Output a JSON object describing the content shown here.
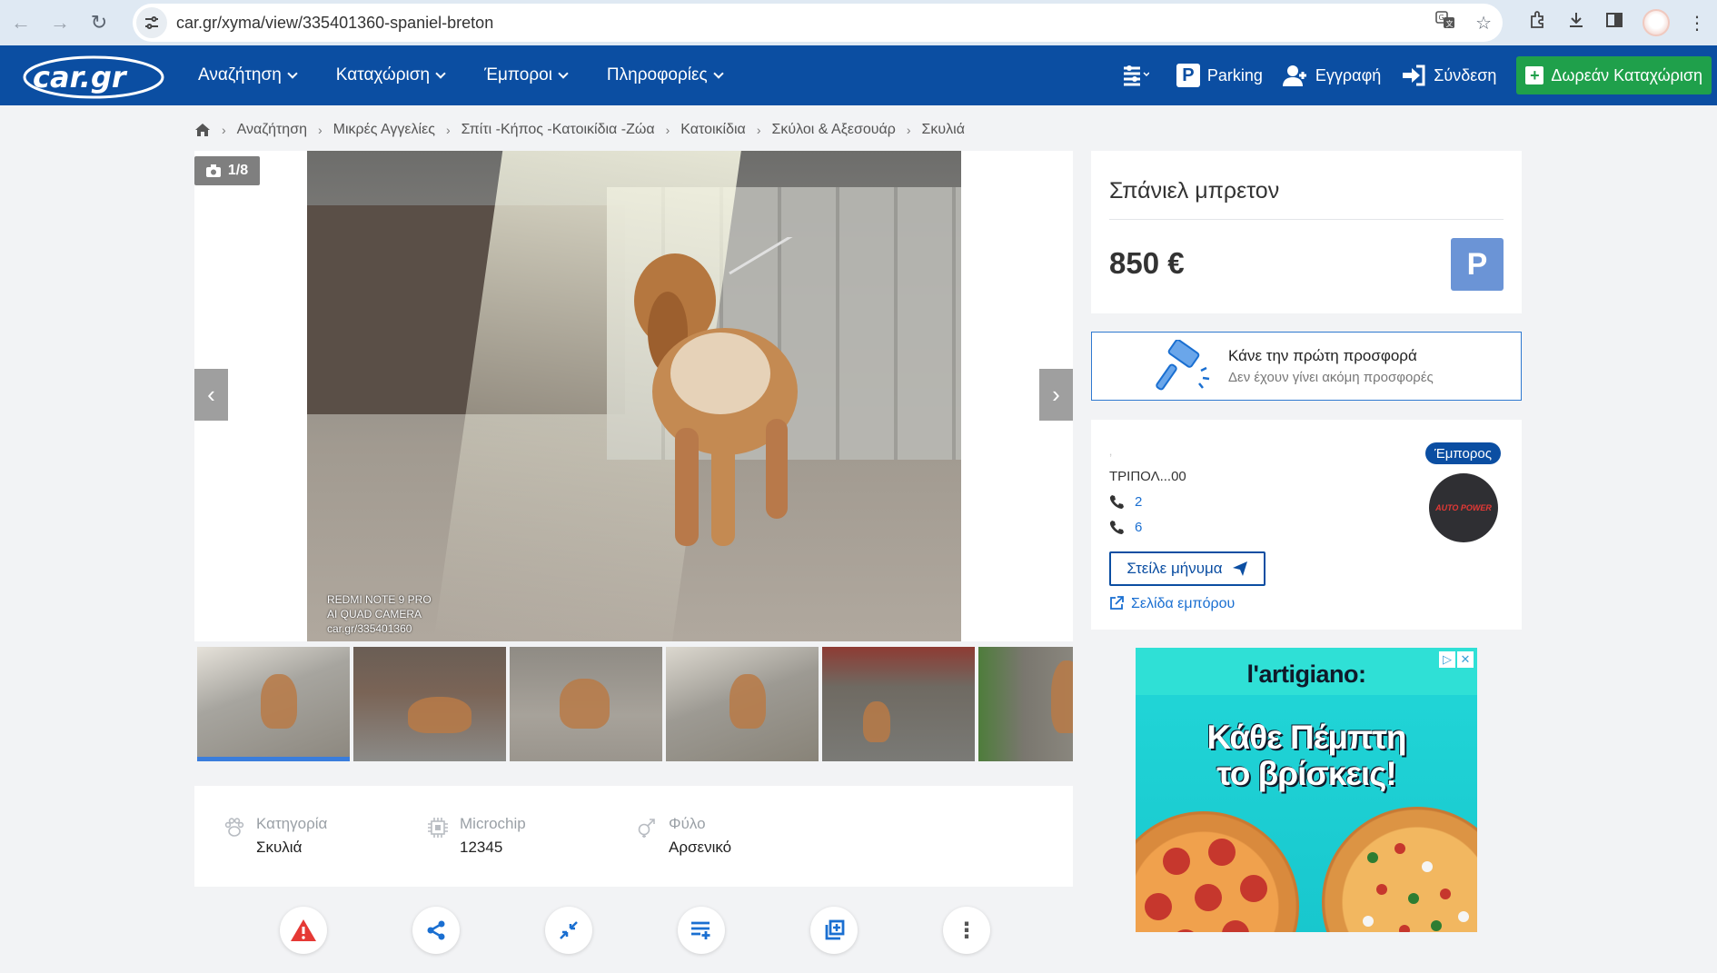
{
  "browser": {
    "url": "car.gr/xyma/view/335401360-spaniel-breton"
  },
  "header": {
    "logo": "car.gr",
    "menu": [
      {
        "label": "Αναζήτηση"
      },
      {
        "label": "Καταχώριση"
      },
      {
        "label": "Έμποροι"
      },
      {
        "label": "Πληροφορίες"
      }
    ],
    "parking_label": "Parking",
    "register_label": "Εγγραφή",
    "login_label": "Σύνδεση",
    "free_listing_label": "Δωρεάν Καταχώριση"
  },
  "breadcrumb": [
    "Αναζήτηση",
    "Μικρές Αγγελίες",
    "Σπίτι -Κήπος -Κατοικίδια -Ζώα",
    "Κατοικίδια",
    "Σκύλοι & Αξεσουάρ",
    "Σκυλιά"
  ],
  "gallery": {
    "counter": "1/8",
    "caption_line1": "REDMI NOTE 9 PRO",
    "caption_line2": "AI QUAD CAMERA",
    "caption_line3": "car.gr/335401360",
    "thumbnails": 6,
    "active_thumbnail": 1
  },
  "attributes": [
    {
      "label": "Κατηγορία",
      "value": "Σκυλιά",
      "icon": "paw-icon"
    },
    {
      "label": "Microchip",
      "value": "12345",
      "icon": "chip-icon"
    },
    {
      "label": "Φύλο",
      "value": "Αρσενικό",
      "icon": "gender-icon"
    }
  ],
  "listing": {
    "title": "Σπάνιελ μπρετον",
    "price": "850 €",
    "park_letter": "P"
  },
  "offer": {
    "title": "Κάνε την πρώτη προσφορά",
    "subtitle": "Δεν έχουν γίνει ακόμη προσφορές"
  },
  "dealer": {
    "tag": "Έμπορος",
    "city": "ΤΡΙΠΟΛ...00",
    "phone1": "2",
    "phone2": "6",
    "message_label": "Στείλε μήνυμα",
    "page_link": "Σελίδα εμπόρου",
    "logo_text": "AUTO POWER"
  },
  "ad": {
    "brand": "l'artigiano:",
    "line1": "Κάθε Πέμπτη",
    "line2": "το βρίσκεις!"
  },
  "colors": {
    "header_bg": "#0b4ea2",
    "free_btn": "#1fa04b",
    "accent": "#1a6fd1"
  }
}
